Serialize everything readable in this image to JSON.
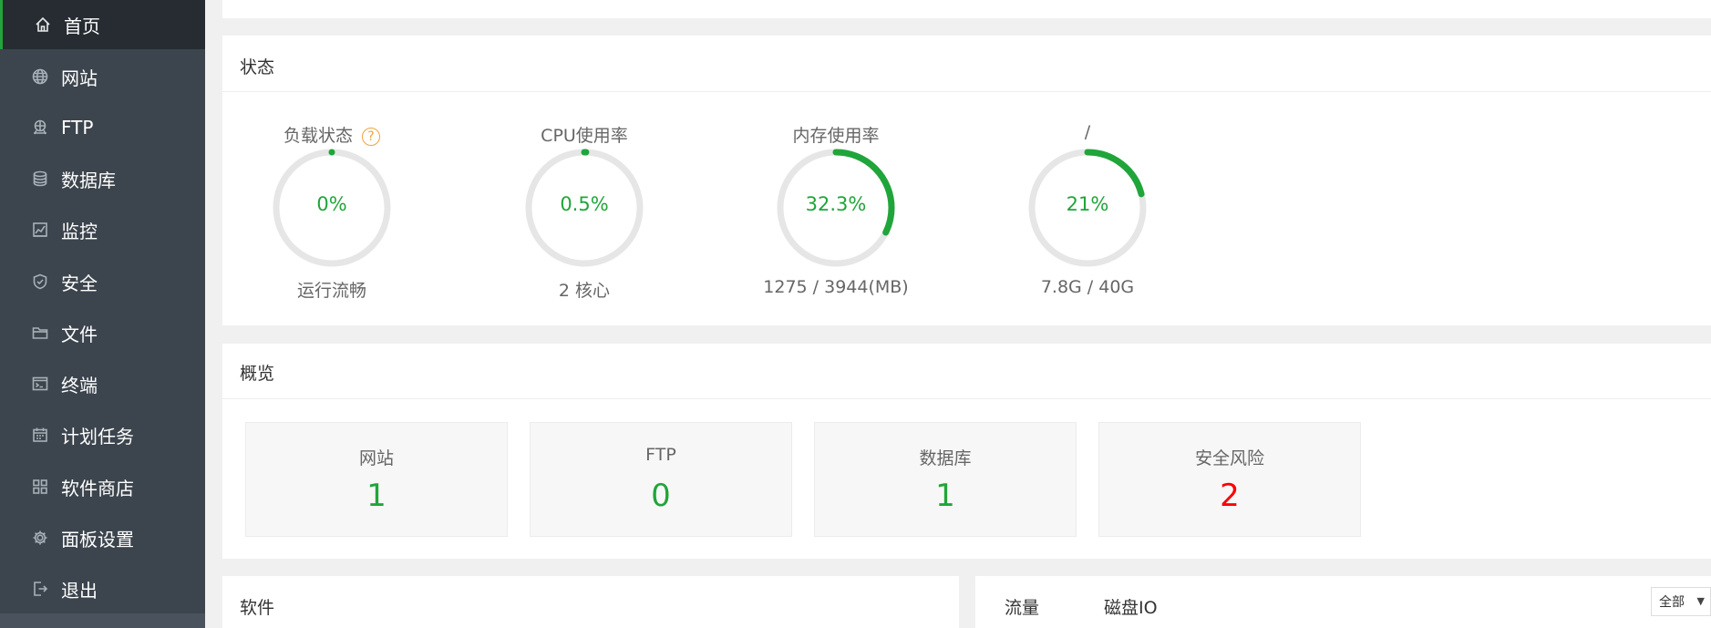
{
  "sidebar": {
    "items": [
      {
        "label": "首页",
        "icon": "home-icon",
        "active": true
      },
      {
        "label": "网站",
        "icon": "globe-icon"
      },
      {
        "label": "FTP",
        "icon": "ftp-icon"
      },
      {
        "label": "数据库",
        "icon": "database-icon"
      },
      {
        "label": "监控",
        "icon": "monitor-icon"
      },
      {
        "label": "安全",
        "icon": "shield-icon"
      },
      {
        "label": "文件",
        "icon": "folder-icon"
      },
      {
        "label": "终端",
        "icon": "terminal-icon"
      },
      {
        "label": "计划任务",
        "icon": "calendar-icon"
      },
      {
        "label": "软件商店",
        "icon": "grid-icon"
      },
      {
        "label": "面板设置",
        "icon": "gear-icon"
      },
      {
        "label": "退出",
        "icon": "logout-icon"
      }
    ]
  },
  "status": {
    "title": "状态",
    "help_icon_text": "?",
    "gauges": [
      {
        "title": "负载状态",
        "value": "0%",
        "percent": 0,
        "sub": "运行流畅"
      },
      {
        "title": "CPU使用率",
        "value": "0.5%",
        "percent": 0.5,
        "sub": "2 核心"
      },
      {
        "title": "内存使用率",
        "value": "32.3%",
        "percent": 32.3,
        "sub": "1275 / 3944(MB)"
      },
      {
        "title": "/",
        "value": "21%",
        "percent": 21,
        "sub": "7.8G / 40G"
      }
    ]
  },
  "overview": {
    "title": "概览",
    "cards": [
      {
        "label": "网站",
        "value": "1"
      },
      {
        "label": "FTP",
        "value": "0"
      },
      {
        "label": "数据库",
        "value": "1"
      },
      {
        "label": "安全风险",
        "value": "2",
        "danger": true
      }
    ]
  },
  "software": {
    "title": "软件"
  },
  "traffic": {
    "tabs": [
      "流量",
      "磁盘IO"
    ],
    "select_value": "全部",
    "select_arrow": "▼"
  },
  "colors": {
    "accent": "#20a53a",
    "danger": "#ff0000",
    "sidebar_bg": "#3c444d",
    "track": "#e6e6e6"
  }
}
